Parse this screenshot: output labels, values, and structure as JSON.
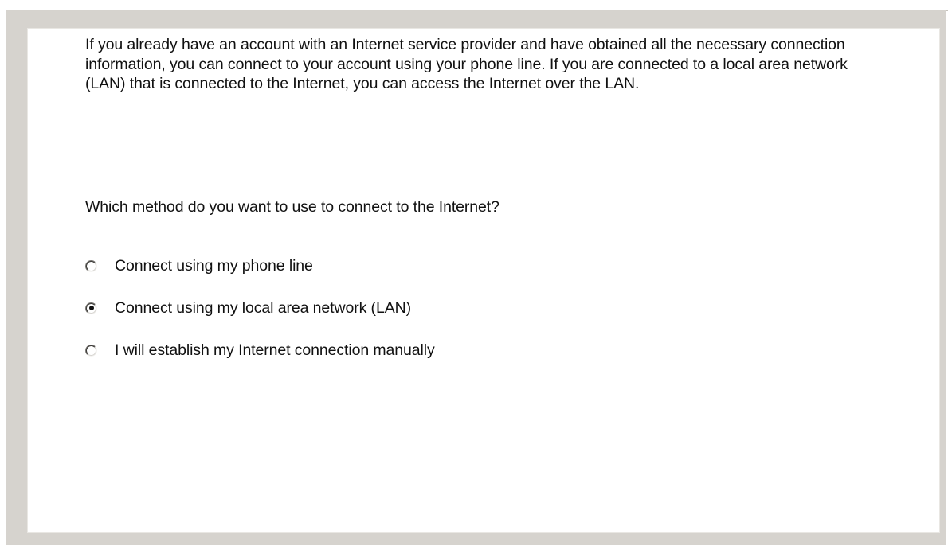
{
  "wizard": {
    "intro_text": "If you already have an account with an Internet service provider and have obtained all the necessary connection information, you can connect to your account using your phone line. If you are connected to a local area network (LAN) that is connected to the Internet, you can access the Internet over the LAN.",
    "question": "Which method do you want to use to connect to the Internet?",
    "options": [
      {
        "label": "Connect using my phone line",
        "selected": false
      },
      {
        "label": "Connect using my local area network (LAN)",
        "selected": true
      },
      {
        "label": "I will establish my Internet connection manually",
        "selected": false
      }
    ],
    "colors": {
      "dialog_background": "#d6d3ce",
      "panel_background": "#ffffff",
      "text": "#111111"
    }
  }
}
